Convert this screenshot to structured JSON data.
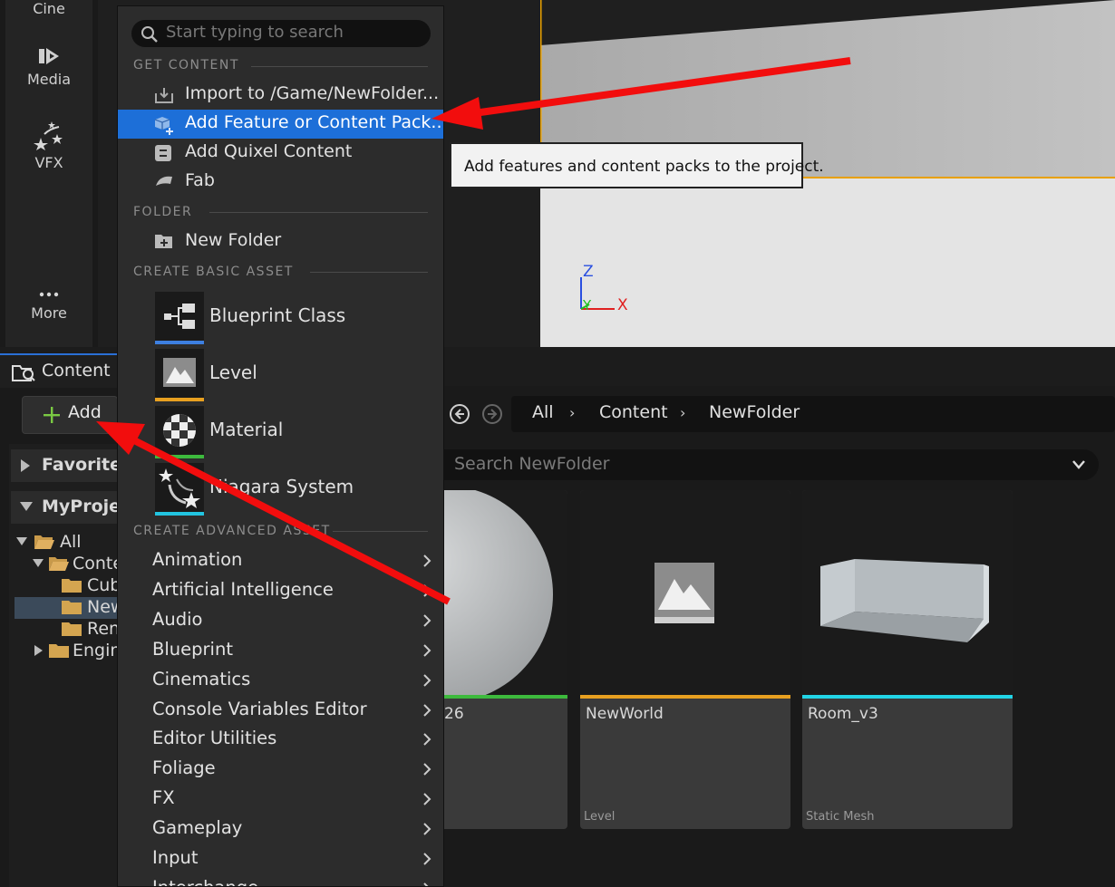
{
  "toolbar": {
    "cine": "Cine",
    "media": "Media",
    "vfx": "VFX",
    "more": "More"
  },
  "viewport": {
    "axis_z": "Z",
    "axis_y": "Y",
    "axis_x": "X"
  },
  "content_browser": {
    "tab_label": "Content B",
    "add_label": "Add",
    "favorites": "Favorites",
    "project": "MyProjec",
    "tree": [
      "All",
      "Conte",
      "Cub",
      "New",
      "Ren",
      "Engin"
    ],
    "breadcrumb": [
      "All",
      "Content",
      "NewFolder"
    ],
    "search_placeholder": "Search NewFolder",
    "tiles": [
      {
        "name": "26",
        "type": ""
      },
      {
        "name": "NewWorld",
        "type": "Level"
      },
      {
        "name": "Room_v3",
        "type": "Static Mesh"
      }
    ]
  },
  "menu": {
    "search_placeholder": "Start typing to search",
    "get_content_header": "GET CONTENT",
    "get_content": [
      "Import to /Game/NewFolder...",
      "Add Feature or Content Pack...",
      "Add Quixel Content",
      "Fab"
    ],
    "folder_header": "FOLDER",
    "new_folder": "New Folder",
    "basic_header": "CREATE BASIC ASSET",
    "basic_assets": [
      "Blueprint Class",
      "Level",
      "Material",
      "Niagara System"
    ],
    "advanced_header": "CREATE ADVANCED ASSET",
    "advanced": [
      "Animation",
      "Artificial Intelligence",
      "Audio",
      "Blueprint",
      "Cinematics",
      "Console Variables Editor",
      "Editor Utilities",
      "Foliage",
      "FX",
      "Gameplay",
      "Input",
      "Interchange"
    ]
  },
  "tooltip": "Add features and content packs to the project.",
  "colors": {
    "highlight": "#1d6fd8",
    "arrow": "#f20d0d",
    "blueprint_bar": "#3d7fe0",
    "level_bar": "#e8a020",
    "material_bar": "#3dba3d",
    "niagara_bar": "#22c4e0",
    "mesh_bar": "#22d4e6"
  }
}
